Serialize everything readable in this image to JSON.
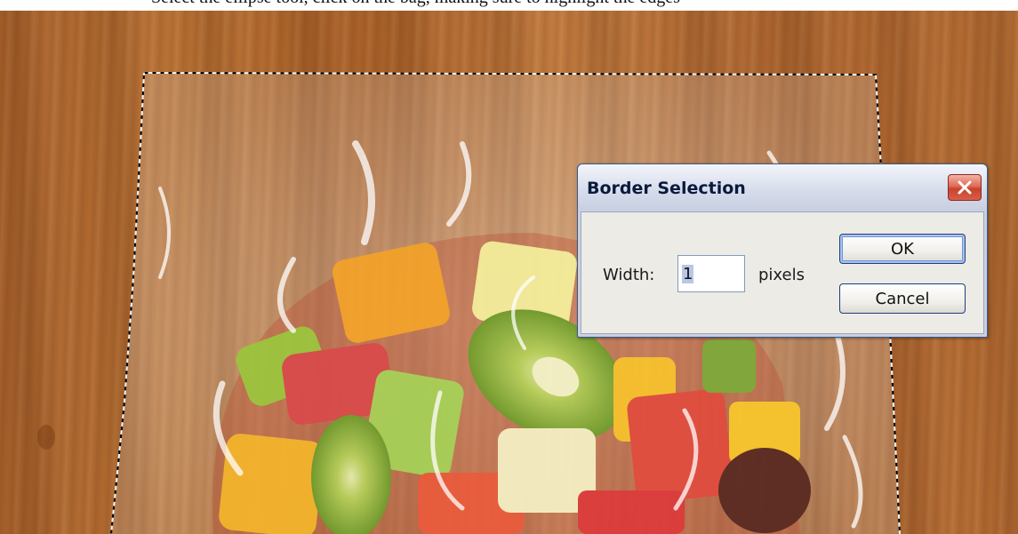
{
  "page": {
    "top_caption": "Select the ellipse tool, click on the bag, making sure to highlight the edges"
  },
  "canvas": {
    "wood_color": "#b46c33",
    "selection_style": "marching-ants"
  },
  "dialog": {
    "title": "Border Selection",
    "close_icon": "close-icon",
    "width_label": "Width:",
    "width_value": "1",
    "unit_label": "pixels",
    "ok_label": "OK",
    "cancel_label": "Cancel"
  },
  "colors": {
    "dialog_title_text": "#0a1a3c",
    "close_button": "#d85e48",
    "default_button_ring": "#6f95d8"
  }
}
